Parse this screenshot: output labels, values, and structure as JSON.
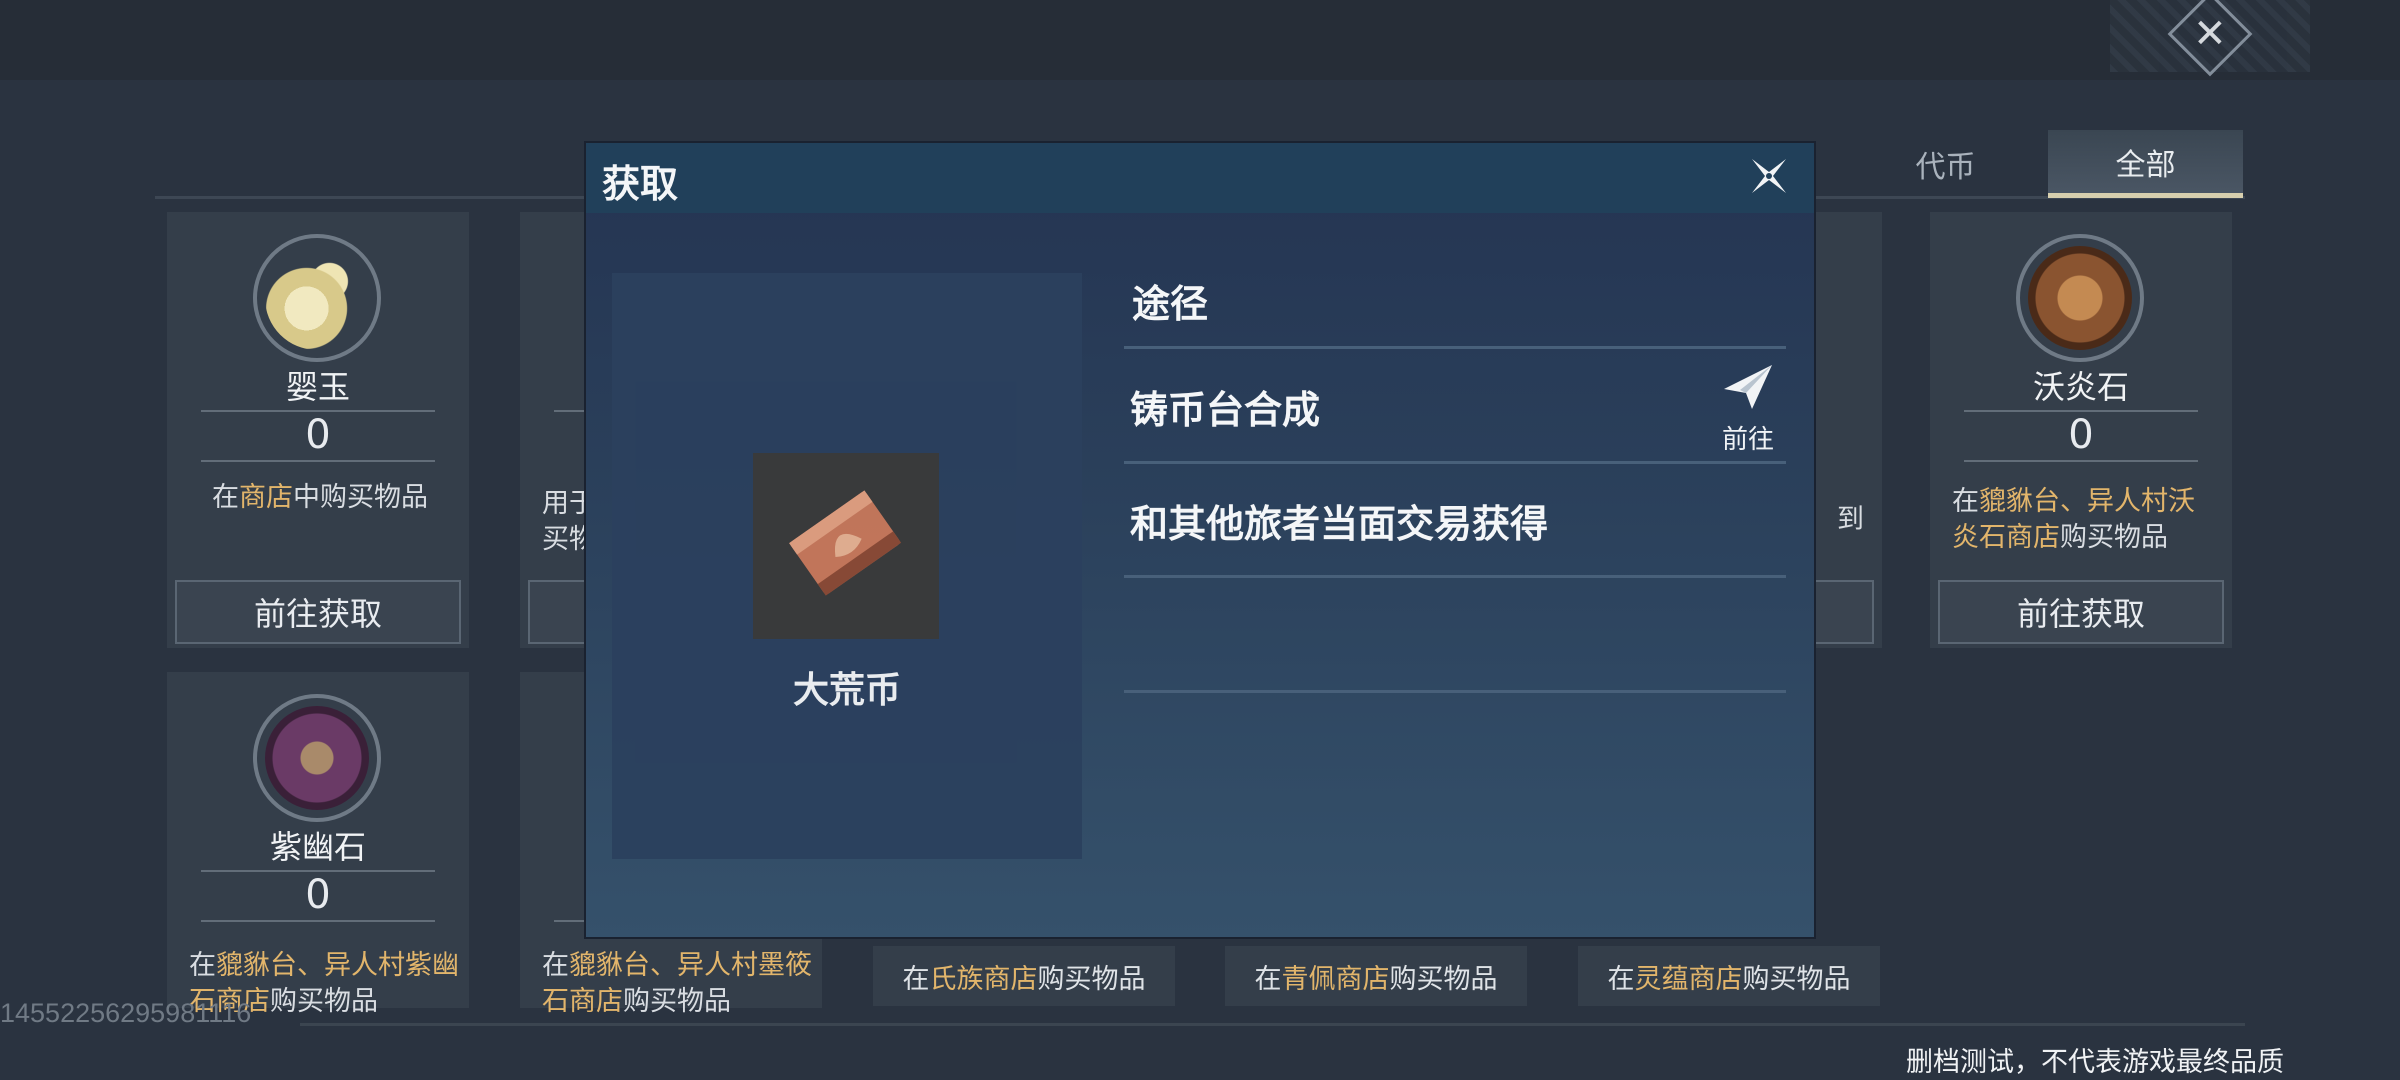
{
  "filter_tabs": [
    {
      "label": "代币",
      "active": false
    },
    {
      "label": "全部",
      "active": true
    }
  ],
  "cards": [
    {
      "name": "婴玉",
      "count": "0",
      "desc_parts": [
        {
          "t": "在",
          "hl": false
        },
        {
          "t": "商店",
          "hl": true
        },
        {
          "t": "中购买物品",
          "hl": false
        }
      ],
      "button": "前往获取",
      "icon": "pale-jade-icon"
    },
    {
      "name": "",
      "count": "",
      "desc_parts": [
        {
          "t": "用于",
          "hl": false
        },
        {
          "t": "买物",
          "hl": false
        }
      ],
      "button": "",
      "icon": ""
    },
    {
      "name": "",
      "count": "",
      "desc_parts": [
        {
          "t": "到",
          "hl": false
        }
      ],
      "button": "",
      "icon": ""
    },
    {
      "name": "沃炎石",
      "count": "0",
      "desc_parts": [
        {
          "t": "在",
          "hl": false
        },
        {
          "t": "貔貅台、异人村沃炎石商店",
          "hl": true
        },
        {
          "t": "购买物品",
          "hl": false
        }
      ],
      "button": "前往获取",
      "icon": "amber-stone-icon"
    },
    {
      "name": "紫幽石",
      "count": "0",
      "desc_parts": [
        {
          "t": "在",
          "hl": false
        },
        {
          "t": "貔貅台、异人村紫幽石商店",
          "hl": true
        },
        {
          "t": "购买物品",
          "hl": false
        }
      ],
      "button": "",
      "icon": "purple-stone-icon"
    },
    {
      "name": "",
      "count": "",
      "desc_parts": [
        {
          "t": "在",
          "hl": false
        },
        {
          "t": "貔貅台、异人村墨筱石商店",
          "hl": true
        },
        {
          "t": "购买物品",
          "hl": false
        }
      ],
      "button": "",
      "icon": ""
    }
  ],
  "bottom_descs": [
    {
      "pre": "在",
      "hl": "氏族商店",
      "post": "购买物品"
    },
    {
      "pre": "在",
      "hl": "青佩商店",
      "post": "购买物品"
    },
    {
      "pre": "在",
      "hl": "灵蕴商店",
      "post": "购买物品"
    }
  ],
  "partial_texts": {
    "card2_line1": "用于",
    "card2_line2": "买物",
    "card3_tail": "到"
  },
  "watermark_id": "14552256295981116",
  "disclaimer": "删档测试，不代表游戏最终品质",
  "modal": {
    "title": "获取",
    "item_name": "大荒币",
    "routes_header": "途径",
    "routes": [
      {
        "label": "铸币台合成",
        "action": "前往"
      },
      {
        "label": "和其他旅者当面交易获得",
        "action": ""
      }
    ]
  },
  "colors": {
    "highlight": "#e2b56b",
    "modal_bg": "#2a3f5a",
    "card_bg": "#343e4a"
  }
}
